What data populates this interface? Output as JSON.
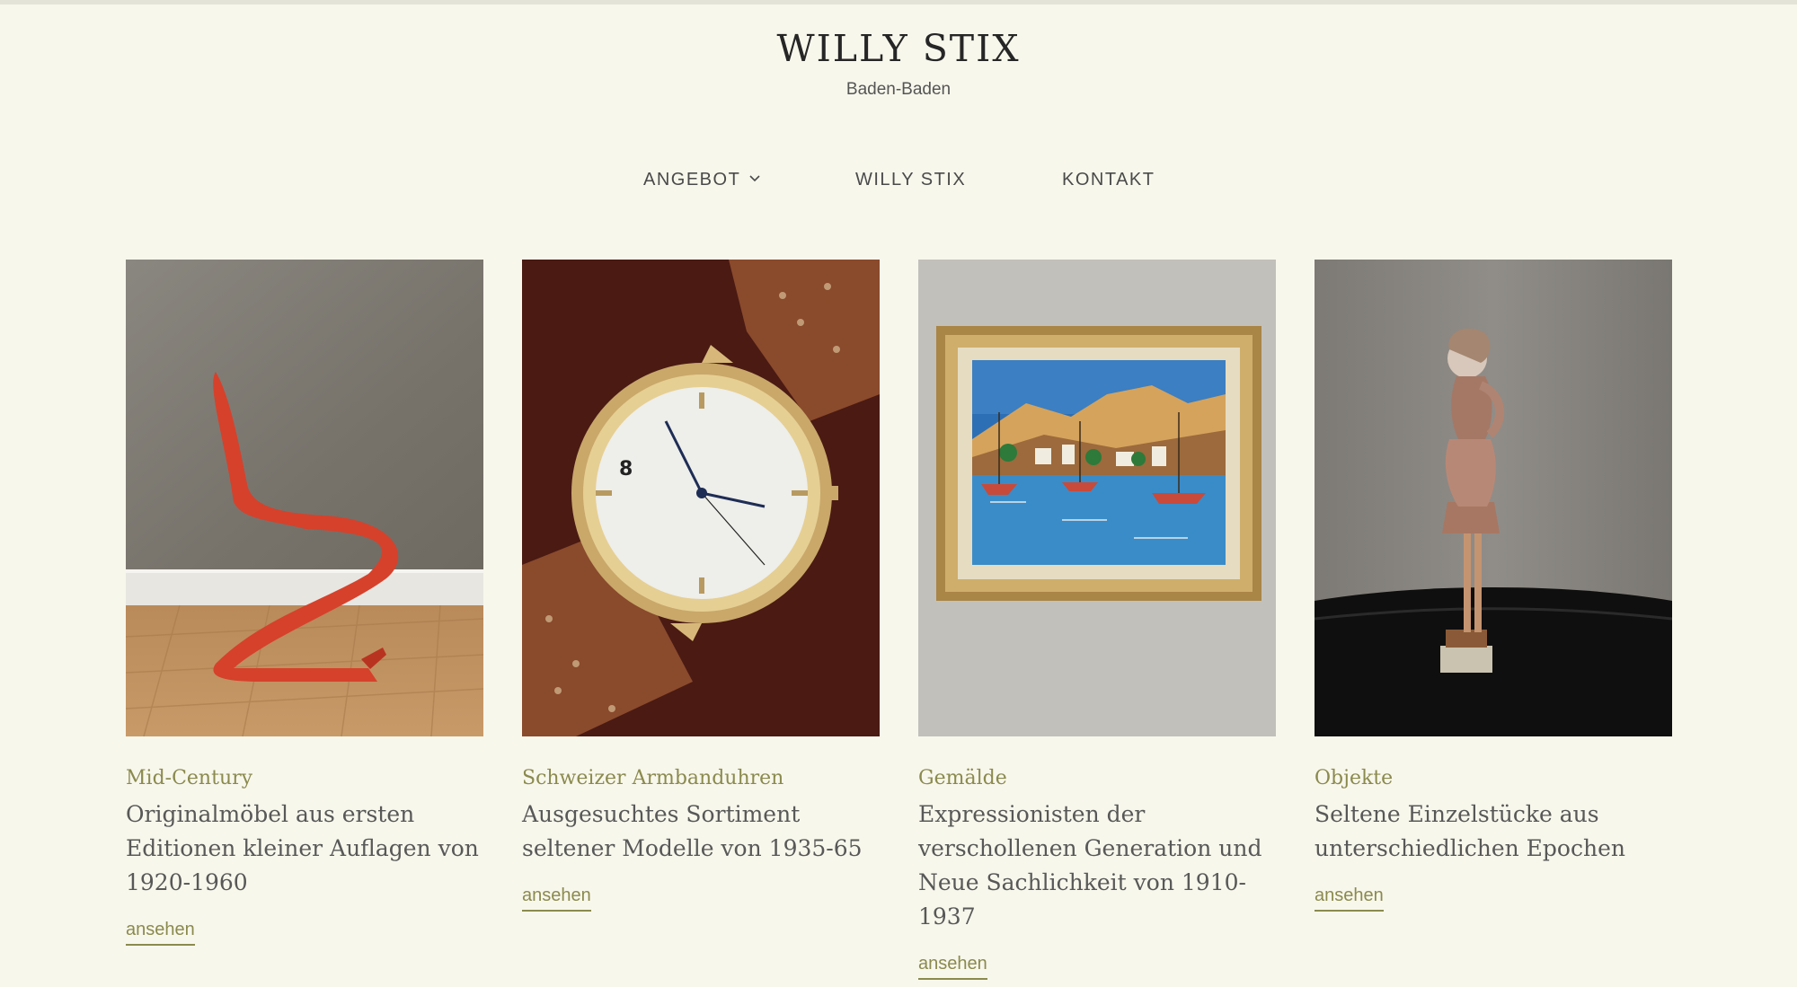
{
  "header": {
    "title": "WILLY STIX",
    "subtitle": "Baden-Baden"
  },
  "nav": {
    "items": [
      {
        "label": "ANGEBOT",
        "has_dropdown": true
      },
      {
        "label": "WILLY STIX",
        "has_dropdown": false
      },
      {
        "label": "KONTAKT",
        "has_dropdown": false
      }
    ]
  },
  "cards": [
    {
      "category": "Mid-Century",
      "description": "Originalmöbel aus ersten Editionen kleiner Auflagen von 1920-1960",
      "link": "ansehen",
      "image": "red-cantilever-chair"
    },
    {
      "category": "Schweizer Armbanduhren",
      "description": "Ausgesuchtes Sortiment seltener Modelle von 1935-65",
      "link": "ansehen",
      "image": "gold-wristwatch"
    },
    {
      "category": "Gemälde",
      "description": "Expressionisten der verschollenen Generation und Neue Sachlichkeit von 1910-1937",
      "link": "ansehen",
      "image": "framed-harbor-painting"
    },
    {
      "category": "Objekte",
      "description": "Seltene Einzelstücke aus unterschiedlichen Epochen",
      "link": "ansehen",
      "image": "bronze-figurine"
    }
  ],
  "colors": {
    "background": "#F8F7EC",
    "accent": "#8A8A4E",
    "title": "#262626",
    "text": "#585858"
  }
}
